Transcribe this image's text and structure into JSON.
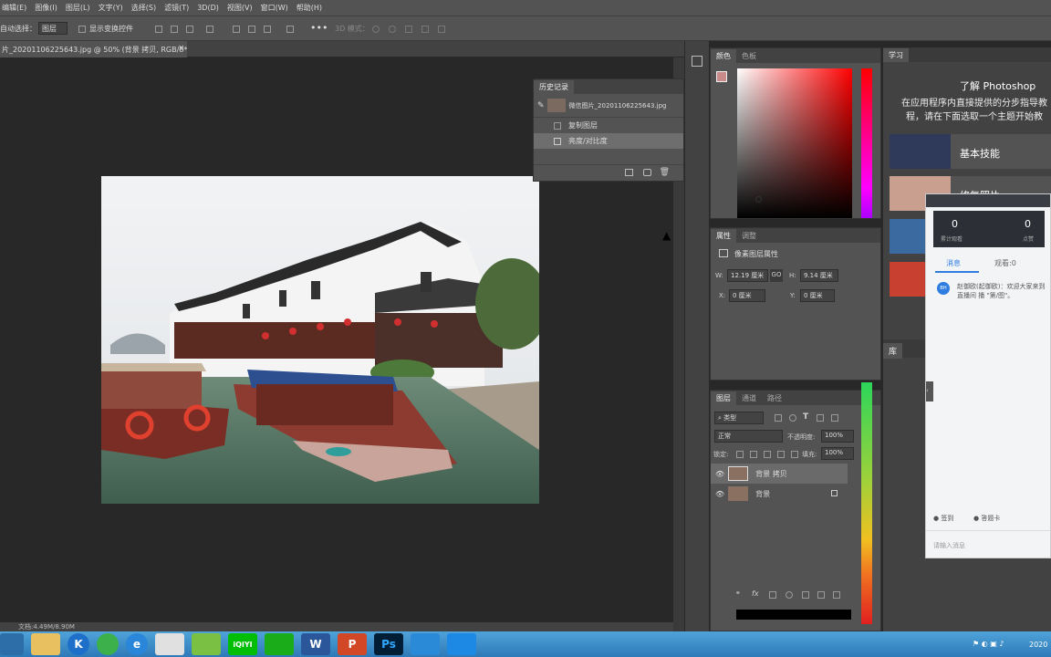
{
  "menu": [
    "编辑(E)",
    "图像(I)",
    "图层(L)",
    "文字(Y)",
    "选择(S)",
    "滤镜(T)",
    "3D(D)",
    "视图(V)",
    "窗口(W)",
    "帮助(H)"
  ],
  "options": {
    "auto_select_label": "自动选择：",
    "auto_select_value": "图层",
    "show_transform": "显示变换控件",
    "mode_3d": "3D 模式："
  },
  "document": {
    "tab_title": "片_20201106225643.jpg @ 50% (背景 拷贝, RGB/8*) *",
    "status": "文档:4.49M/8.90M"
  },
  "history": {
    "title": "历史记录",
    "snapshot": "微信图片_20201106225643.jpg",
    "items": [
      "复制图层",
      "亮度/对比度"
    ]
  },
  "color_panel": {
    "tabs": [
      "颜色",
      "色板"
    ],
    "fg_color": "#c98a8a"
  },
  "properties": {
    "tabs": [
      "属性",
      "调整"
    ],
    "heading": "像素图层属性",
    "w_label": "W:",
    "w": "12.19 厘米",
    "h_label": "H:",
    "h": "9.14 厘米",
    "x_label": "X:",
    "x": "0 厘米",
    "y_label": "Y:",
    "y": "0 厘米",
    "link": "GO"
  },
  "layers": {
    "tabs": [
      "图层",
      "通道",
      "路径"
    ],
    "filter": "类型",
    "blend": "正常",
    "opacity_label": "不透明度:",
    "opacity": "100%",
    "lock_label": "锁定:",
    "fill_label": "填充:",
    "fill": "100%",
    "items": [
      {
        "name": "背景 拷贝",
        "selected": true
      },
      {
        "name": "背景",
        "selected": false,
        "locked": true
      }
    ]
  },
  "learn": {
    "tab": "学习",
    "title": "了解 Photoshop",
    "desc": "在应用程序内直接提供的分步指导教程，请在下面选取一个主题开始教程。",
    "cards": [
      "基本技能",
      "修复照片",
      "",
      ""
    ],
    "lib_tab": "库"
  },
  "chat": {
    "stats": [
      {
        "value": "0",
        "label": "累计观看"
      },
      {
        "value": "0",
        "label": "点赞"
      }
    ],
    "tabs": [
      "消息",
      "观看:0"
    ],
    "msg_user": "BH",
    "msg": "赵御欧(起御欧)：欢迎大家来到直播间 播 \"第/图\"。",
    "btn1": "签到",
    "btn2": "答题卡",
    "input_placeholder": "请输入消息"
  },
  "taskbar": {
    "apps": [
      "",
      "K",
      "",
      "e",
      "",
      "",
      "iQIYI",
      "",
      "W",
      "P",
      "Ps",
      "",
      ""
    ],
    "time": "2020"
  }
}
